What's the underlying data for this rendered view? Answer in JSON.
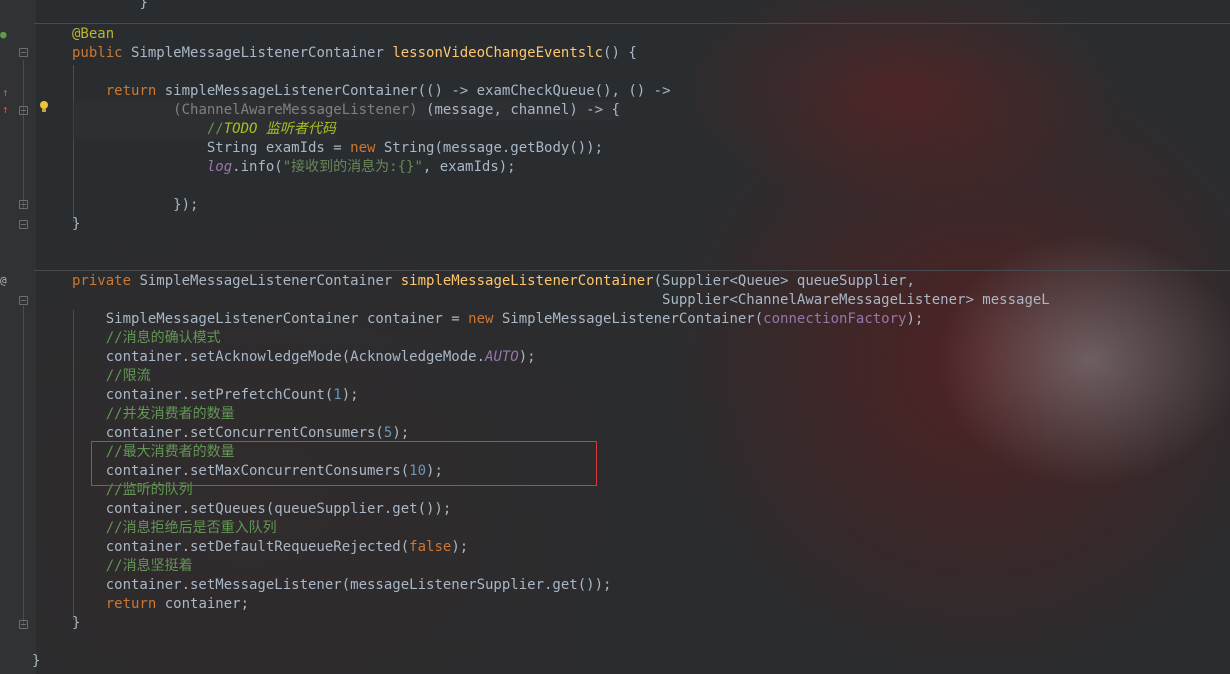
{
  "editor": {
    "lines": [
      {
        "segs": [
          [
            "cls",
            "        "
          ],
          [
            "cls",
            "}"
          ]
        ]
      },
      {
        "segs": [
          [
            "ann",
            "@Bean"
          ]
        ]
      },
      {
        "segs": [
          [
            "kw",
            "public "
          ],
          [
            "cls",
            "SimpleMessageListenerContainer "
          ],
          [
            "fn",
            "lessonVideoChangeEventslc"
          ],
          [
            "cls",
            "() {"
          ]
        ]
      },
      {
        "segs": []
      },
      {
        "segs": [
          [
            "cls",
            "    "
          ],
          [
            "kw",
            "return "
          ],
          [
            "cls",
            "simpleMessageListenerContainer"
          ],
          [
            "cls",
            "(() -> "
          ],
          [
            "cls",
            "examCheckQueue"
          ],
          [
            "cls",
            "(), () ->"
          ]
        ]
      },
      {
        "segs": [
          [
            "cls",
            "            "
          ],
          [
            "cast",
            "(ChannelAwareMessageListener) "
          ],
          [
            "cls",
            "(message, channel) -> {"
          ]
        ]
      },
      {
        "segs": [
          [
            "cls",
            "                "
          ],
          [
            "cmt",
            "//"
          ],
          [
            "todo",
            "TODO "
          ],
          [
            "todo",
            "监听者代码"
          ]
        ]
      },
      {
        "segs": [
          [
            "cls",
            "                String examIds = "
          ],
          [
            "kw",
            "new "
          ],
          [
            "cls",
            "String(message.getBody());"
          ]
        ]
      },
      {
        "segs": [
          [
            "cls",
            "                "
          ],
          [
            "static",
            "log"
          ],
          [
            "cls",
            ".info("
          ],
          [
            "str",
            "\"接收到的消息为:{}\""
          ],
          [
            "cls",
            ", examIds);"
          ]
        ]
      },
      {
        "segs": []
      },
      {
        "segs": [
          [
            "cls",
            "            });"
          ]
        ]
      },
      {
        "segs": [
          [
            "cls",
            "}"
          ]
        ]
      },
      {
        "segs": []
      },
      {
        "segs": []
      },
      {
        "segs": [
          [
            "kw",
            "private "
          ],
          [
            "cls",
            "SimpleMessageListenerContainer "
          ],
          [
            "fn",
            "simpleMessageListenerContainer"
          ],
          [
            "cls",
            "(Supplier<Queue> queueSupplier,"
          ]
        ]
      },
      {
        "segs": [
          [
            "cls",
            "                                                                      Supplier<ChannelAwareMessageListener> messageL"
          ]
        ]
      },
      {
        "segs": [
          [
            "cls",
            "    SimpleMessageListenerContainer container = "
          ],
          [
            "kw",
            "new "
          ],
          [
            "cls",
            "SimpleMessageListenerContainer("
          ],
          [
            "field",
            "connectionFactory"
          ],
          [
            "cls",
            ");"
          ]
        ]
      },
      {
        "segs": [
          [
            "cls",
            "    "
          ],
          [
            "cmt",
            "//消息的确认模式"
          ]
        ]
      },
      {
        "segs": [
          [
            "cls",
            "    container.setAcknowledgeMode(AcknowledgeMode."
          ],
          [
            "static",
            "AUTO"
          ],
          [
            "cls",
            ");"
          ]
        ]
      },
      {
        "segs": [
          [
            "cls",
            "    "
          ],
          [
            "cmt",
            "//限流"
          ]
        ]
      },
      {
        "segs": [
          [
            "cls",
            "    container.setPrefetchCount("
          ],
          [
            "num",
            "1"
          ],
          [
            "cls",
            ");"
          ]
        ]
      },
      {
        "segs": [
          [
            "cls",
            "    "
          ],
          [
            "cmt",
            "//并发消费者的数量"
          ]
        ]
      },
      {
        "segs": [
          [
            "cls",
            "    container.setConcurrentConsumers("
          ],
          [
            "num",
            "5"
          ],
          [
            "cls",
            ");"
          ]
        ]
      },
      {
        "segs": [
          [
            "cls",
            "    "
          ],
          [
            "cmt",
            "//最大消费者的数量"
          ]
        ]
      },
      {
        "segs": [
          [
            "cls",
            "    container.setMaxConcurrentConsumers("
          ],
          [
            "num",
            "10"
          ],
          [
            "cls",
            ");"
          ]
        ]
      },
      {
        "segs": [
          [
            "cls",
            "    "
          ],
          [
            "cmt",
            "//监听的队列"
          ]
        ]
      },
      {
        "segs": [
          [
            "cls",
            "    container.setQueues(queueSupplier.get());"
          ]
        ]
      },
      {
        "segs": [
          [
            "cls",
            "    "
          ],
          [
            "cmt",
            "//消息拒绝后是否重入队列"
          ]
        ]
      },
      {
        "segs": [
          [
            "cls",
            "    container.setDefaultRequeueRejected("
          ],
          [
            "kw",
            "false"
          ],
          [
            "cls",
            ");"
          ]
        ]
      },
      {
        "segs": [
          [
            "cls",
            "    "
          ],
          [
            "cmt",
            "//消息坚挺着"
          ]
        ]
      },
      {
        "segs": [
          [
            "cls",
            "    container.setMessageListener(messageListenerSupplier.get());"
          ]
        ]
      },
      {
        "segs": [
          [
            "cls",
            "    "
          ],
          [
            "kw",
            "return "
          ],
          [
            "cls",
            "container;"
          ]
        ]
      },
      {
        "segs": [
          [
            "cls",
            "}"
          ]
        ]
      },
      {
        "segs": []
      },
      {
        "segs": [
          [
            "cls",
            "}"
          ]
        ]
      }
    ]
  },
  "gutter": {
    "at_sign": "@",
    "override_arrow": "↑"
  }
}
